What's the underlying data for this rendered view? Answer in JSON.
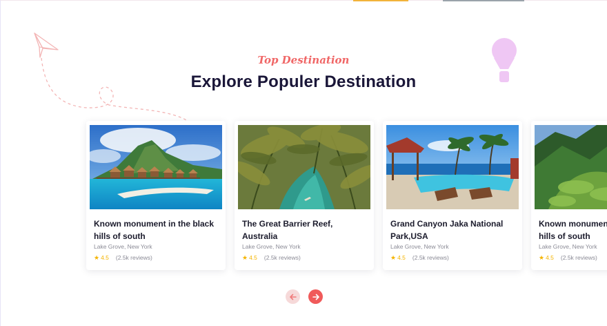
{
  "section": {
    "subtitle": "Top Destination",
    "title": "Explore Populer Destination"
  },
  "destinations": [
    {
      "name": "Known monument in the black hills of south",
      "location": "Lake Grove, New York",
      "rating": "4.5",
      "reviews": "(2.5k reviews)",
      "image": "tropical island with overwater bungalows"
    },
    {
      "name": "The Great Barrier Reef, Australia",
      "location": "Lake Grove, New York",
      "rating": "4.5",
      "reviews": "(2.5k reviews)",
      "image": "palm trees over lagoon with canoe"
    },
    {
      "name": "Grand Canyon  Jaka National Park,USA",
      "location": "Lake Grove, New York",
      "rating": "4.5",
      "reviews": "(2.5k reviews)",
      "image": "resort pool with palm trees and sea"
    },
    {
      "name": "Known monument in the black hills of south",
      "location": "Lake Grove, New York",
      "rating": "4.5",
      "reviews": "(2.5k reviews)",
      "image": "green mountains and valley"
    }
  ],
  "icons": {
    "star": "star-icon",
    "prev": "arrow-left-icon",
    "next": "arrow-right-icon",
    "plane": "paper-plane-icon",
    "balloon": "hot-air-balloon-icon"
  },
  "colors": {
    "accent": "#f05a5a",
    "subtitle": "#f06767",
    "title": "#1a1638",
    "star": "#f4b400"
  }
}
